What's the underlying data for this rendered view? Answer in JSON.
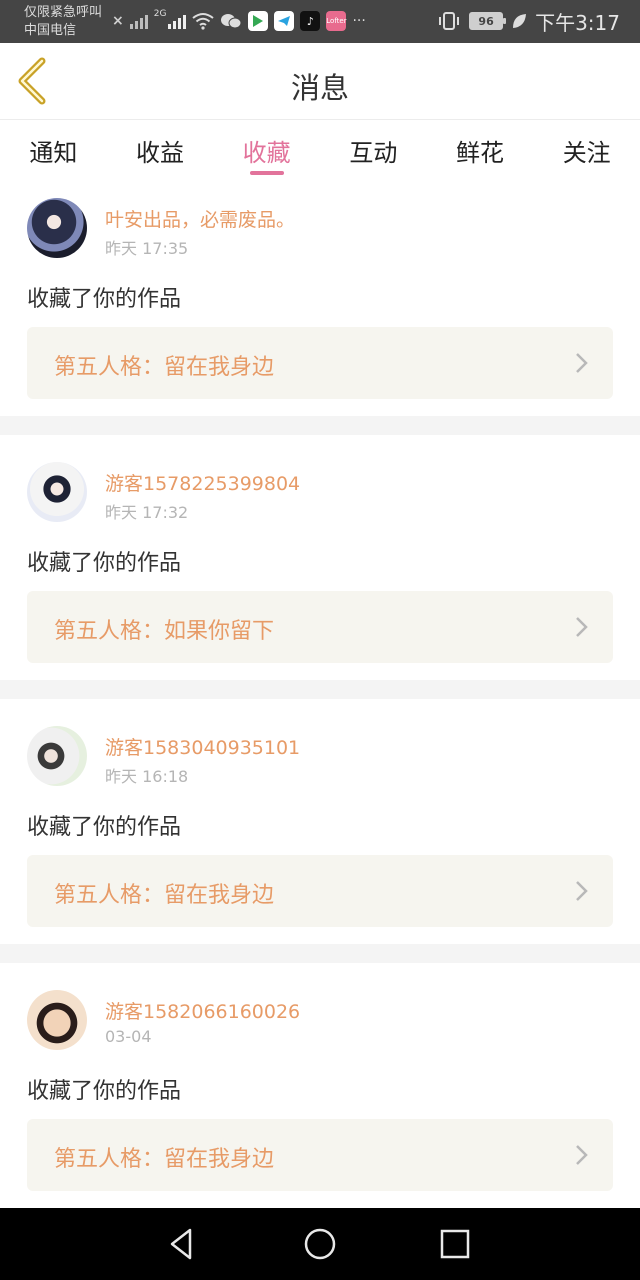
{
  "status_bar": {
    "line1": "仅限紧急呼叫",
    "line2": "中国电信",
    "network": "2G",
    "battery": "96",
    "time": "下午3:17",
    "more": "···"
  },
  "header": {
    "title": "消息"
  },
  "tabs": [
    {
      "label": "通知"
    },
    {
      "label": "收益"
    },
    {
      "label": "收藏",
      "active": true
    },
    {
      "label": "互动"
    },
    {
      "label": "鲜花"
    },
    {
      "label": "关注"
    }
  ],
  "messages": [
    {
      "user": "叶安出品，必需废品。",
      "time": "昨天 17:35",
      "action": "收藏了你的作品",
      "work": "第五人格：留在我身边"
    },
    {
      "user": "游客1578225399804",
      "time": "昨天 17:32",
      "action": "收藏了你的作品",
      "work": "第五人格：如果你留下"
    },
    {
      "user": "游客1583040935101",
      "time": "昨天 16:18",
      "action": "收藏了你的作品",
      "work": "第五人格：留在我身边"
    },
    {
      "user": "游客1582066160026",
      "time": "03-04",
      "action": "收藏了你的作品",
      "work": "第五人格：留在我身边"
    }
  ],
  "colors": {
    "accent": "#e2739b",
    "name": "#e79b67",
    "back": "#c9a227",
    "card_bg": "#f6f5ef"
  }
}
